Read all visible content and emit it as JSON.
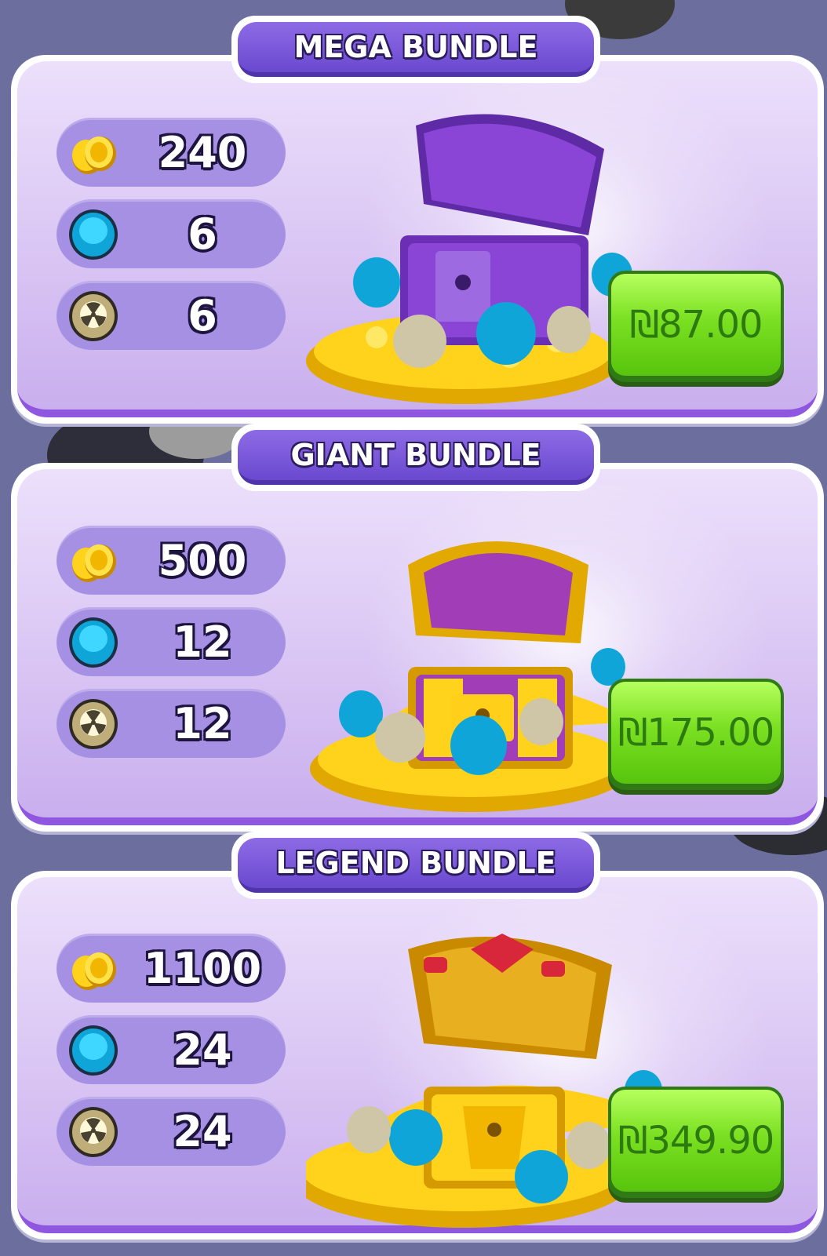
{
  "bundles": [
    {
      "title": "MEGA BUNDLE",
      "price": "₪87.00",
      "chest": "purple-chest",
      "rewards": [
        {
          "icon": "gold-coins-icon",
          "value": "240"
        },
        {
          "icon": "blue-gem-icon",
          "value": "6"
        },
        {
          "icon": "nuke-orb-icon",
          "value": "6"
        }
      ]
    },
    {
      "title": "GIANT BUNDLE",
      "price": "₪175.00",
      "chest": "gold-purple-chest",
      "rewards": [
        {
          "icon": "gold-coins-icon",
          "value": "500"
        },
        {
          "icon": "blue-gem-icon",
          "value": "12"
        },
        {
          "icon": "nuke-orb-icon",
          "value": "12"
        }
      ]
    },
    {
      "title": "LEGEND BUNDLE",
      "price": "₪349.90",
      "chest": "gold-ruby-chest",
      "rewards": [
        {
          "icon": "gold-coins-icon",
          "value": "1100"
        },
        {
          "icon": "blue-gem-icon",
          "value": "24"
        },
        {
          "icon": "nuke-orb-icon",
          "value": "24"
        }
      ]
    }
  ],
  "colors": {
    "background": "#6c6f9e",
    "card": "#d8c3f3",
    "title_tab": "#6b49cf",
    "price_button": "#7be022",
    "price_text": "#2c7a10"
  }
}
